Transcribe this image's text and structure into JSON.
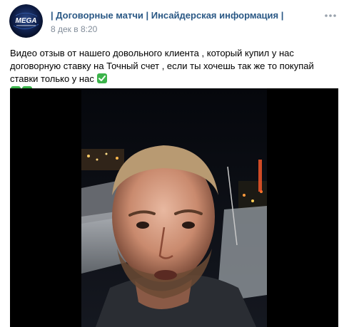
{
  "post": {
    "author": {
      "name": "| Договорные матчи | Инсайдерская информация |",
      "avatar_logo_text": "MEGA",
      "avatar_icon": "mega-logo-icon"
    },
    "date": "8 дек в 8:20",
    "more_icon": "more-horizontal-icon",
    "text": "Видео отзыв от нашего довольного клиента , который купил у нас договорную ставку на Точный счет , если ты хочешь так же то покупай ставки только у нас",
    "emoji": [
      "check-mark-button-icon",
      "check-mark-button-icon",
      "check-mark-button-icon"
    ],
    "video": {
      "icon": "video-thumbnail",
      "scene": "night-harbor-selfie"
    },
    "colors": {
      "link": "#2a5885",
      "meta": "#818c99",
      "check_green": "#3cb44b",
      "video_bg": "#000000"
    }
  }
}
